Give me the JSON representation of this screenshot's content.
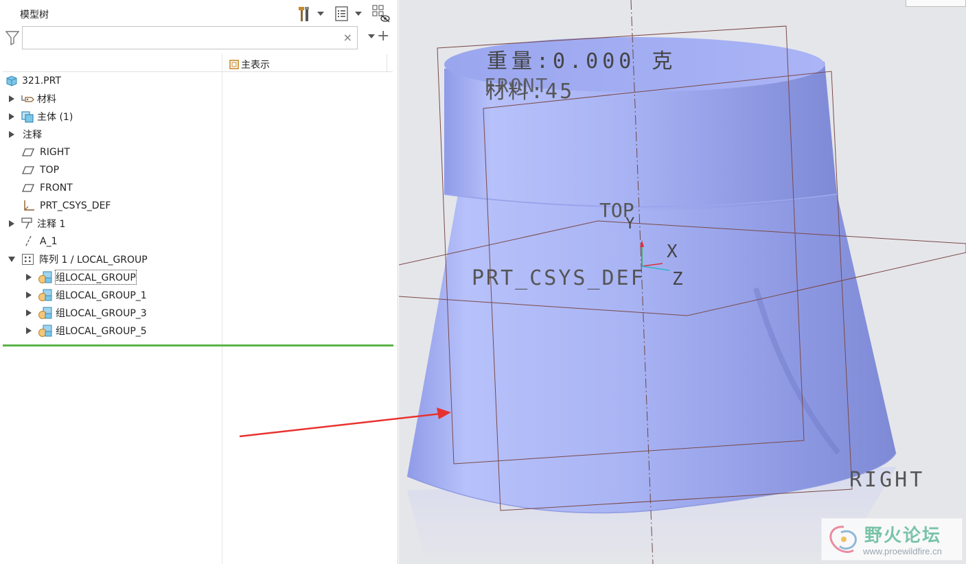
{
  "panel": {
    "title": "模型树",
    "search": {
      "value": "",
      "placeholder": ""
    },
    "clear_symbol": "×",
    "add_symbol": "+",
    "column2_header": "主表示"
  },
  "tree": {
    "items": [
      {
        "label": "321.PRT",
        "icon": "part-icon"
      },
      {
        "label": "材料",
        "icon": "material-icon"
      },
      {
        "label": "主体 (1)",
        "icon": "body-icon"
      },
      {
        "label": "注释",
        "icon": "none"
      },
      {
        "label": "RIGHT",
        "icon": "datum-plane-icon"
      },
      {
        "label": "TOP",
        "icon": "datum-plane-icon"
      },
      {
        "label": "FRONT",
        "icon": "datum-plane-icon"
      },
      {
        "label": "PRT_CSYS_DEF",
        "icon": "csys-icon"
      },
      {
        "label": "注释 1",
        "icon": "annotation-icon"
      },
      {
        "label": "A_1",
        "icon": "axis-icon"
      },
      {
        "label": "阵列 1 / LOCAL_GROUP",
        "icon": "pattern-icon"
      },
      {
        "label": "组LOCAL_GROUP",
        "icon": "group-icon"
      },
      {
        "label": "组LOCAL_GROUP_1",
        "icon": "group-icon"
      },
      {
        "label": "组LOCAL_GROUP_3",
        "icon": "group-icon"
      },
      {
        "label": "组LOCAL_GROUP_5",
        "icon": "group-icon"
      }
    ]
  },
  "viewport": {
    "annotation_weight": "重量:0.000 克",
    "annotation_material": "材料:45",
    "plane_front": "FRONT",
    "plane_top": "TOP",
    "plane_right": "RIGHT",
    "csys_label": "PRT_CSYS_DEF",
    "axis_x": "X",
    "axis_y": "Y",
    "axis_z": "Z",
    "model_color": "#a9b4f4",
    "arrow_color": "#e8322f"
  },
  "watermark": {
    "name": "野火论坛",
    "url": "www.proewildfire.cn"
  }
}
